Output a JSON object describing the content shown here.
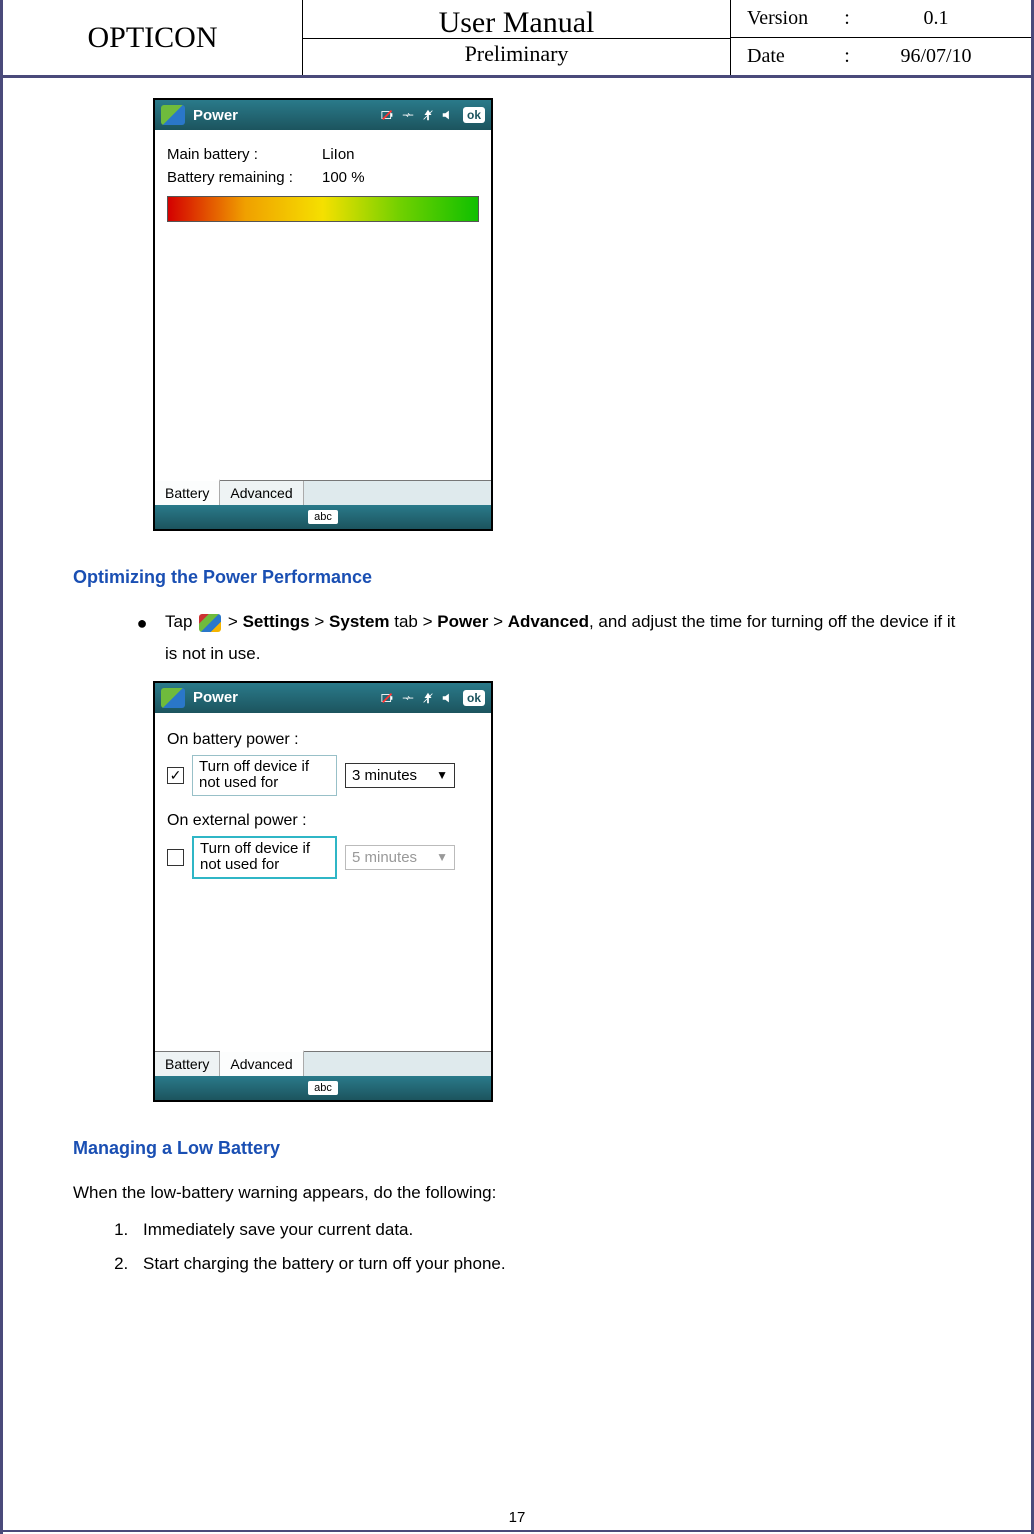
{
  "header": {
    "brand": "OPTICON",
    "title": "User Manual",
    "subtitle": "Preliminary",
    "version_label": "Version",
    "version_value": "0.1",
    "date_label": "Date",
    "date_value": "96/07/10",
    "sep": ":"
  },
  "shot1": {
    "title": "Power",
    "ok": "ok",
    "main_battery_label": "Main battery :",
    "main_battery_value": "LiIon",
    "remaining_label": "Battery remaining :",
    "remaining_value": "100 %",
    "tab_battery": "Battery",
    "tab_advanced": "Advanced",
    "sip": "abc"
  },
  "section1": {
    "title": "Optimizing the Power Performance",
    "bullet_pre": "Tap",
    "path_settings": "Settings",
    "path_system": "System",
    "word_tab": "tab",
    "path_power": "Power",
    "path_advanced": "Advanced",
    "bullet_post": ", and adjust the time for turning off the device if it is not in use.",
    "gt": ">"
  },
  "shot2": {
    "title": "Power",
    "ok": "ok",
    "on_battery": "On battery power :",
    "on_external": "On external power :",
    "chk_label": "Turn off device if not used for",
    "val_battery": "3 minutes",
    "val_external": "5 minutes",
    "tab_battery": "Battery",
    "tab_advanced": "Advanced",
    "sip": "abc",
    "check": "✓"
  },
  "section2": {
    "title": "Managing a Low Battery",
    "intro": "When the low-battery warning appears, do the following:",
    "step1": "Immediately save your current data.",
    "step2": "Start charging the battery or turn off your phone."
  },
  "page_number": "17"
}
